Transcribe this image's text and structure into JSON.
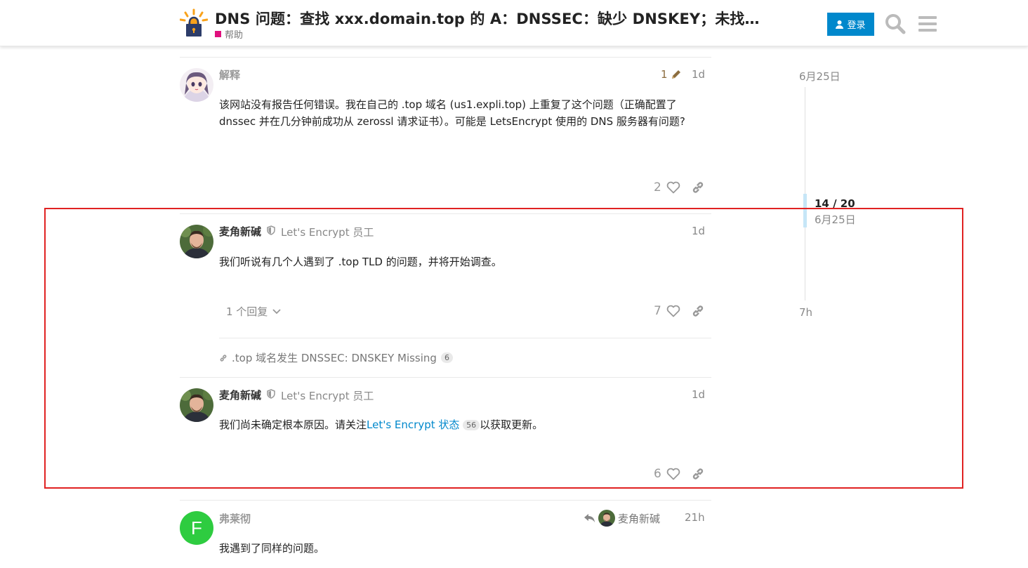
{
  "header": {
    "title": "DNS 问题：查找 xxx.domain.top 的 A：DNSSEC：缺少 DNSKEY；未找…",
    "category": "帮助",
    "category_color": "#e0107d",
    "login_label": "登录",
    "accent_color": "#0088cc"
  },
  "posts": [
    {
      "username": "解释",
      "user_title": "",
      "date": "1d",
      "edit_count": "1",
      "body": "该网站没有报告任何错误。我在自己的 .top 域名 (us1.expli.top) 上重复了这个问题（正确配置了 dnssec 并在几分钟前成功从 zerossl 请求证书）。可能是 LetsEncrypt 使用的 DNS 服务器有问题?",
      "likes": "2"
    },
    {
      "username": "麦角新碱",
      "user_title": "Let's Encrypt 员工",
      "date": "1d",
      "body": "我们听说有几个人遇到了 .top TLD 的问题，并将开始调查。",
      "replies_label": "1 个回复",
      "likes": "7"
    },
    {
      "linked_topic": ".top 域名发生 DNSSEC: DNSKEY Missing",
      "linked_topic_count": "6"
    },
    {
      "username": "麦角新碱",
      "user_title": "Let's Encrypt 员工",
      "date": "1d",
      "body_prefix": "我们尚未确定根本原因。请关注",
      "body_link": "Let's Encrypt 状态",
      "body_link_count": "56",
      "body_suffix": "以获取更新。",
      "likes": "6"
    },
    {
      "username": "弗莱彻",
      "avatar_letter": "F",
      "avatar_color": "#2ecc40",
      "reply_to": "麦角新碱",
      "date": "21h",
      "body": "我遇到了同样的问题。"
    }
  ],
  "timeline": {
    "start_date": "6月25日",
    "position": "14 / 20",
    "position_date": "6月25日",
    "end_date": "7h"
  }
}
